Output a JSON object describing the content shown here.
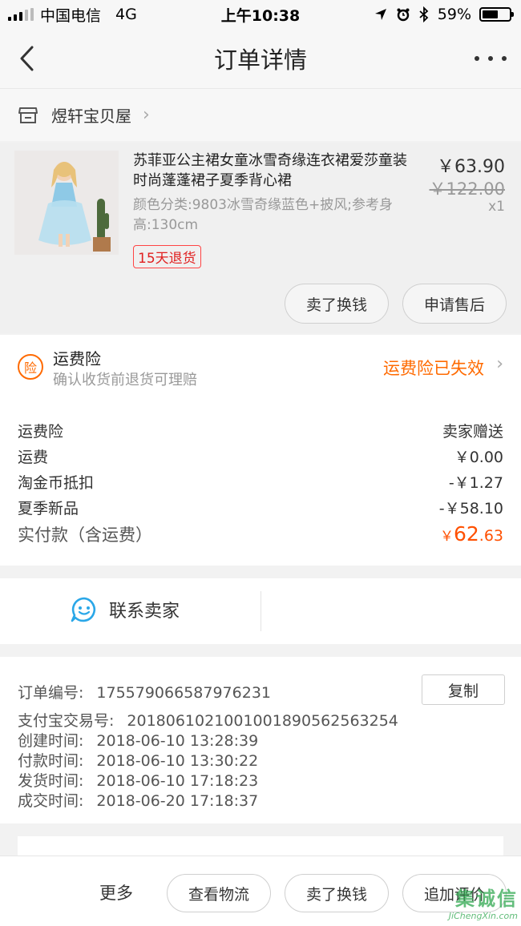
{
  "status_bar": {
    "carrier": "中国电信",
    "network": "4G",
    "time": "上午10:38",
    "battery_percent": "59%",
    "battery_level": 0.59
  },
  "nav": {
    "title": "订单详情",
    "back_icon": "chevron-left-icon",
    "more_icon": "more-dots-icon"
  },
  "shop": {
    "name": "煜轩宝贝屋"
  },
  "product": {
    "title": "苏菲亚公主裙女童冰雪奇缘连衣裙爱莎童装时尚蓬蓬裙子夏季背心裙",
    "spec": "颜色分类:9803冰雪奇缘蓝色+披风;参考身高:130cm",
    "badge": "15天退货",
    "price": "￥63.90",
    "original_price": "￥122.00",
    "quantity": "x1",
    "actions": [
      "卖了换钱",
      "申请售后"
    ]
  },
  "insurance": {
    "icon_label": "险",
    "title": "运费险",
    "subtitle": "确认收货前退货可理赔",
    "status": "运费险已失效"
  },
  "costs": {
    "rows": [
      {
        "label": "运费险",
        "value": "卖家赠送"
      },
      {
        "label": "运费",
        "value": "￥0.00"
      },
      {
        "label": "淘金币抵扣",
        "value": "-￥1.27"
      },
      {
        "label": "夏季新品",
        "value": "-￥58.10"
      }
    ],
    "total_label": "实付款（含运费）",
    "total_currency": "￥",
    "total_int": "62",
    "total_dec": ".63"
  },
  "contact": {
    "label": "联系卖家"
  },
  "order_info": {
    "copy_label": "复制",
    "rows": [
      {
        "label": "订单编号:",
        "value": "175579066587976231"
      },
      {
        "label": "支付宝交易号:",
        "value": "2018061021001001890562563254"
      },
      {
        "label": "创建时间:",
        "value": "2018-06-10 13:28:39"
      },
      {
        "label": "付款时间:",
        "value": "2018-06-10 13:30:22"
      },
      {
        "label": "发货时间:",
        "value": "2018-06-10 17:18:23"
      },
      {
        "label": "成交时间:",
        "value": "2018-06-20 17:18:37"
      }
    ]
  },
  "bottom": {
    "more": "更多",
    "buttons": [
      "查看物流",
      "卖了换钱",
      "追加评价"
    ]
  },
  "watermark": {
    "logo": "集诚信",
    "url": "JiChengXin.com"
  },
  "colors": {
    "accent": "#ff6a00",
    "price_red": "#ff5000",
    "badge_red": "#e02020",
    "contact_blue": "#2aa7e8"
  }
}
